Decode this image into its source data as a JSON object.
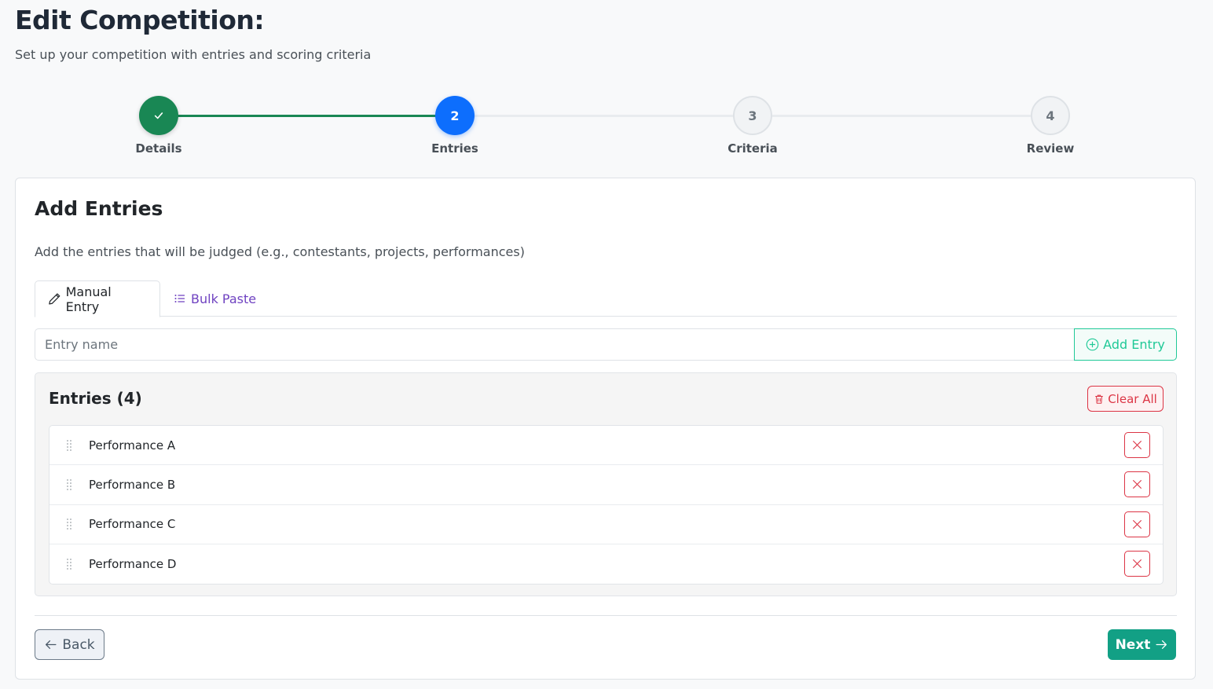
{
  "header": {
    "title": "Edit Competition:",
    "subtitle": "Set up your competition with entries and scoring criteria"
  },
  "stepper": {
    "steps": [
      {
        "number": "1",
        "label": "Details",
        "state": "done"
      },
      {
        "number": "2",
        "label": "Entries",
        "state": "active"
      },
      {
        "number": "3",
        "label": "Criteria",
        "state": "pending"
      },
      {
        "number": "4",
        "label": "Review",
        "state": "pending"
      }
    ]
  },
  "card": {
    "title": "Add Entries",
    "description": "Add the entries that will be judged (e.g., contestants, projects, performances)"
  },
  "tabs": {
    "manual": "Manual Entry",
    "bulk": "Bulk Paste"
  },
  "entry_input": {
    "value": "",
    "placeholder": "Entry name",
    "add_label": "Add Entry"
  },
  "entries": {
    "title": "Entries (4)",
    "clear_label": "Clear All",
    "items": [
      {
        "name": "Performance A"
      },
      {
        "name": "Performance B"
      },
      {
        "name": "Performance C"
      },
      {
        "name": "Performance D"
      }
    ]
  },
  "footer": {
    "back_label": "Back",
    "next_label": "Next"
  },
  "colors": {
    "done": "#198754",
    "active": "#0d6efd",
    "danger": "#dc3545",
    "teal": "#20c997",
    "next": "#12a085",
    "tab_link": "#6f42c1"
  }
}
